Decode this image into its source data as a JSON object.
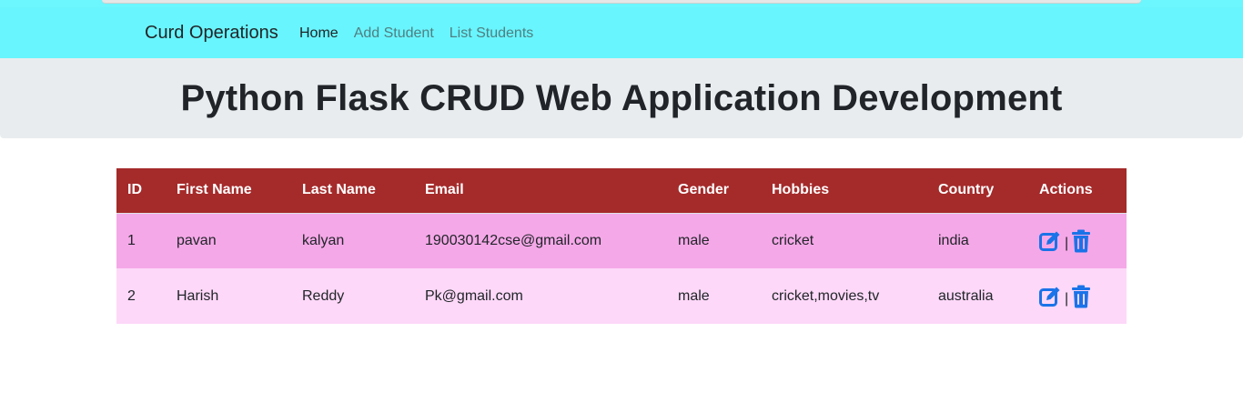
{
  "navbar": {
    "brand": "Curd Operations",
    "links": [
      {
        "label": "Home"
      },
      {
        "label": "Add Student"
      },
      {
        "label": "List Students"
      }
    ]
  },
  "jumbotron": {
    "title": "Python Flask CRUD Web Application Development"
  },
  "table": {
    "headers": [
      "ID",
      "First Name",
      "Last Name",
      "Email",
      "Gender",
      "Hobbies",
      "Country",
      "Actions"
    ],
    "rows": [
      {
        "id": "1",
        "first_name": "pavan",
        "last_name": "kalyan",
        "email": "190030142cse@gmail.com",
        "gender": "male",
        "hobbies": "cricket",
        "country": "india"
      },
      {
        "id": "2",
        "first_name": "Harish",
        "last_name": "Reddy",
        "email": "Pk@gmail.com",
        "gender": "male",
        "hobbies": "cricket,movies,tv",
        "country": "australia"
      }
    ],
    "action_separator": "|"
  },
  "icons": {
    "edit": "edit-icon",
    "delete": "trash-icon"
  },
  "colors": {
    "navbar": "#69f5fd",
    "table_header": "#a52a2a",
    "row_odd": "#f5a8e8",
    "row_even": "#fdd8f8",
    "action_icon": "#1a73e8"
  }
}
